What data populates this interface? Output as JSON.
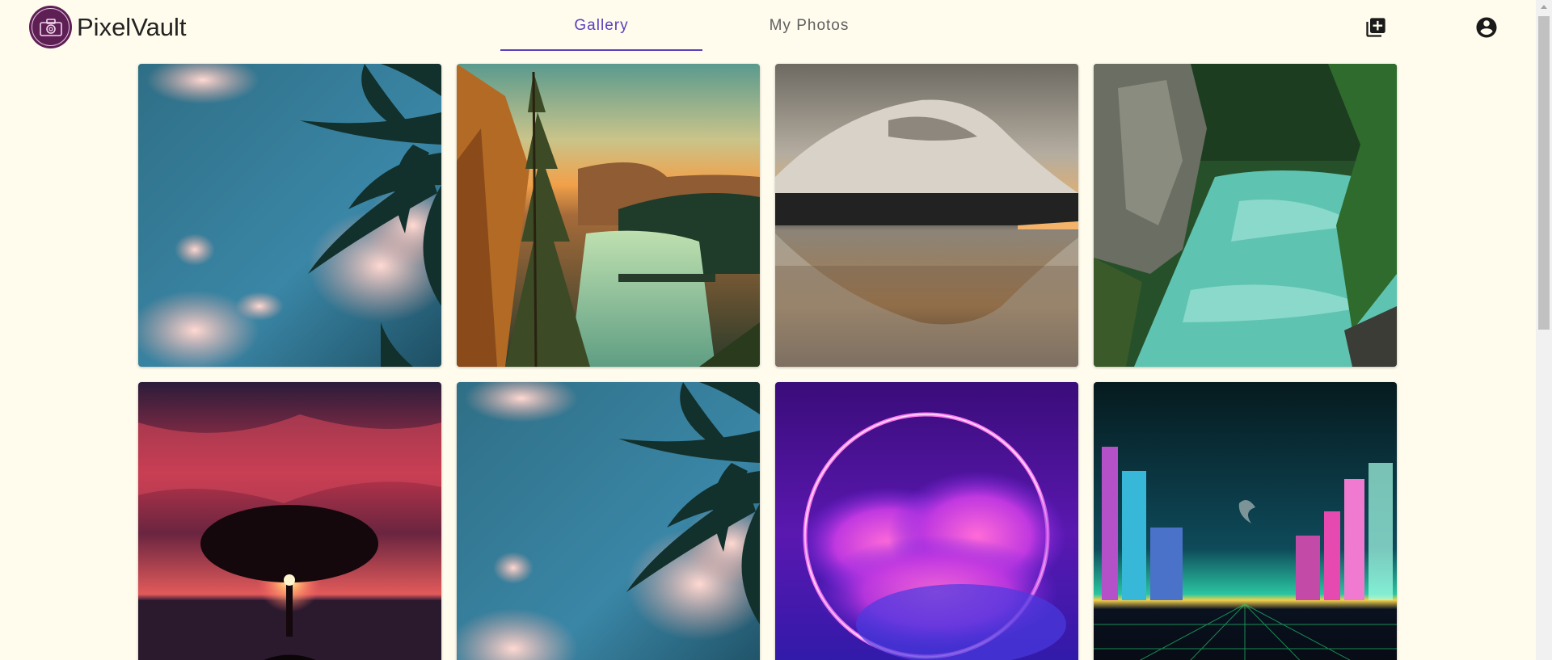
{
  "app": {
    "brand": "PixelVault"
  },
  "nav": {
    "tabs": [
      {
        "label": "Gallery",
        "active": true
      },
      {
        "label": "My Photos",
        "active": false
      }
    ],
    "active_color": "#5b3fbf"
  },
  "icons": {
    "logo": "camera-icon",
    "add": "add-photo-icon",
    "account": "account-circle-icon"
  },
  "gallery": {
    "photos": [
      {
        "subject": "palm-tree-sky"
      },
      {
        "subject": "lake-forest-sunset"
      },
      {
        "subject": "mountain-lake-reflection"
      },
      {
        "subject": "river-canyon"
      },
      {
        "subject": "tree-sunset-silhouette"
      },
      {
        "subject": "palm-tree-sky"
      },
      {
        "subject": "neon-ring-clouds"
      },
      {
        "subject": "neon-city-razer"
      }
    ]
  },
  "colors": {
    "background": "#fffcee",
    "logo_bg": "#5e1f55"
  }
}
